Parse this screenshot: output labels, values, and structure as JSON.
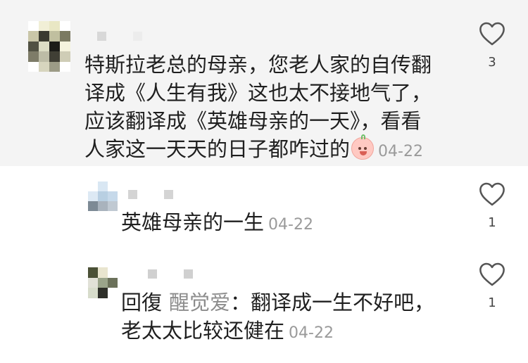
{
  "comments": [
    {
      "text": "特斯拉老总的母亲，您老人家的自传翻\n译成《人生有我》这也太不接地气了，\n应该翻译成《英雄母亲的一天》，看看\n人家这一天天的日子都咋过的",
      "emoji": "blush-face-emoji",
      "date": "04-22",
      "likes": "3",
      "avatar_colors": [
        "#ffffff",
        "#f1efd6",
        "#e9e7c4",
        "#ffffff",
        "#c9c6a8",
        "#3a3a30",
        "#c0bf9f",
        "#7b7a62",
        "#515143",
        "#dcdcc4",
        "#1c1c18",
        "#f5f3dd",
        "#7e7c68",
        "#bdbca6",
        "#403f35",
        "#cfcdb6",
        "#ffffff",
        "#d7d5be",
        "#9c9b86",
        "#ffffff"
      ],
      "username_colors": [
        "#d8d8d8",
        "#ececec"
      ]
    },
    {
      "text": "英雄母亲的一生",
      "date": "04-22",
      "likes": "1",
      "avatar_colors": [
        "#ffffff",
        "#d9e7f3",
        "#ffffff",
        "#dde9f4",
        "#b8cfe2",
        "#c6d9ea",
        "#7d8a95",
        "#a9b3bd",
        "#c0c9d2"
      ],
      "username_colors": [
        "#d4d4d4",
        "#d4d4d4"
      ]
    },
    {
      "reply_prefix": "回復",
      "reply_target": "醒觉爱",
      "text": "：翻译成一生不好吧，\n老太太比较还健在",
      "date": "04-22",
      "likes": "1",
      "avatar_colors": [
        "#4b5136",
        "#e9e5cf",
        "#ffffff",
        "#e1e1d7",
        "#9aa48a",
        "#6b715a",
        "#d7dccb",
        "#2e2f29",
        "#ffffff"
      ],
      "username_colors": [
        "#d0d0d0",
        "#d0d0d0"
      ]
    }
  ],
  "icons": {
    "like": "heart-outline-icon"
  },
  "colors": {
    "main_bg": "#f4f4f4",
    "date": "#9a9a9a",
    "reply_target": "#8c8c8c"
  }
}
